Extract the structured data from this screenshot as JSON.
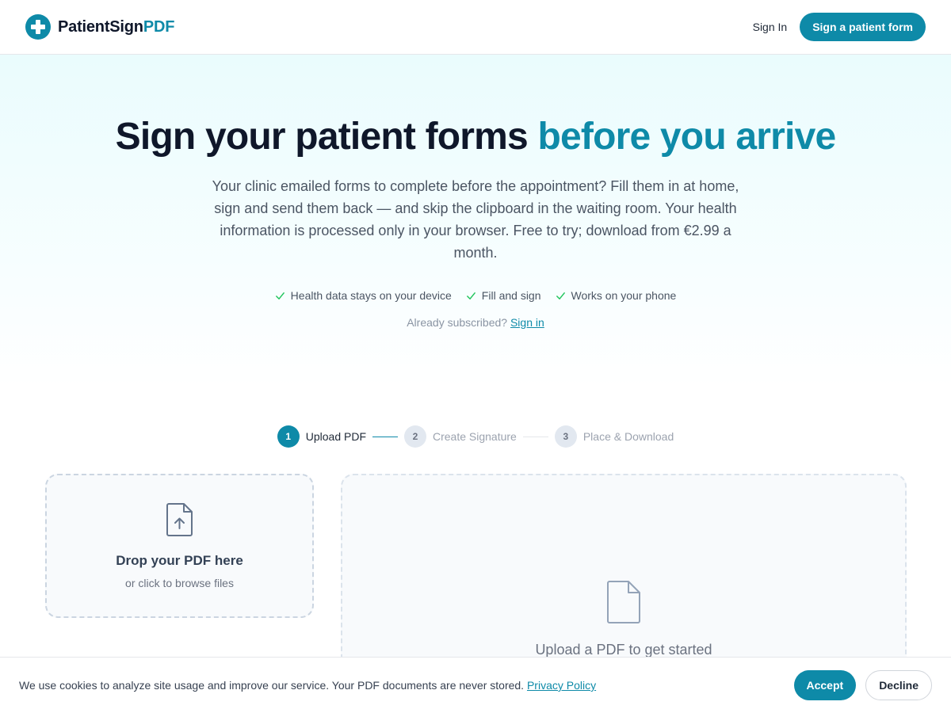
{
  "header": {
    "brand_main": "PatientSign",
    "brand_accent": "PDF",
    "signin_label": "Sign In",
    "cta_label": "Sign a patient form"
  },
  "hero": {
    "title_main": "Sign your patient forms",
    "title_accent": "before you arrive",
    "subtitle": "Your clinic emailed forms to complete before the appointment? Fill them in at home, sign and send them back — and skip the clipboard in the waiting room. Your health information is processed only in your browser. Free to try; download from €2.99 a month.",
    "features": [
      "Health data stays on your device",
      "Fill and sign",
      "Works on your phone"
    ],
    "already_text": "Already subscribed?",
    "already_link": "Sign in"
  },
  "steps": [
    {
      "num": "1",
      "label": "Upload PDF",
      "state": "active"
    },
    {
      "num": "2",
      "label": "Create Signature",
      "state": "inactive"
    },
    {
      "num": "3",
      "label": "Place & Download",
      "state": "inactive"
    }
  ],
  "upload": {
    "title": "Drop your PDF here",
    "subtitle": "or click to browse files"
  },
  "preview": {
    "text": "Upload a PDF to get started"
  },
  "cookie": {
    "text": "We use cookies to analyze site usage and improve our service. Your PDF documents are never stored.",
    "policy_link": "Privacy Policy",
    "accept_label": "Accept",
    "decline_label": "Decline"
  },
  "colors": {
    "accent": "#0e8aa8",
    "check": "#22c55e"
  }
}
